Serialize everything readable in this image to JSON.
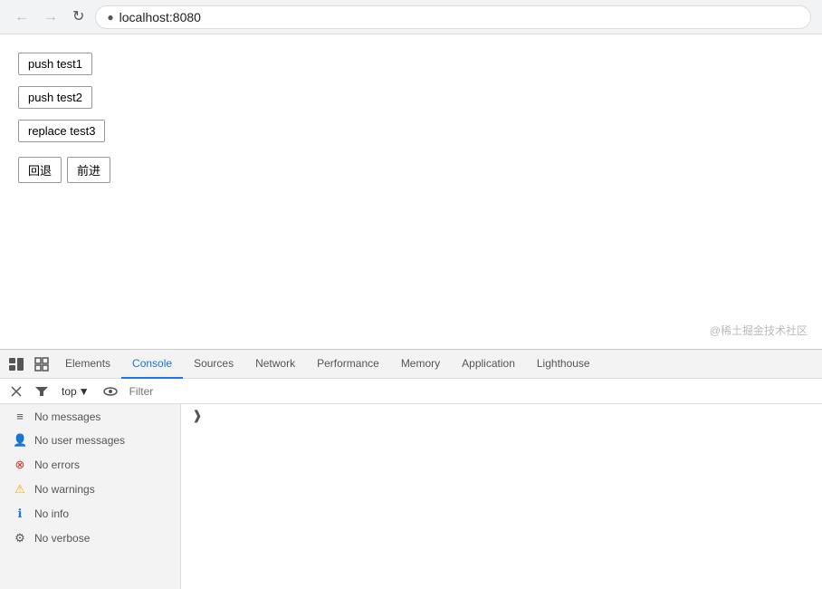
{
  "browser": {
    "url": "localhost:8080",
    "back_disabled": true,
    "forward_disabled": true
  },
  "page": {
    "btn1_label": "push test1",
    "btn2_label": "push test2",
    "btn3_label": "replace test3",
    "back_label": "回退",
    "forward_label": "前进",
    "watermark": "@稀土掘金技术社区"
  },
  "devtools": {
    "tabs": [
      "Elements",
      "Console",
      "Sources",
      "Network",
      "Performance",
      "Memory",
      "Application",
      "Lighthouse"
    ],
    "active_tab": "Console"
  },
  "console": {
    "top_label": "top",
    "filter_placeholder": "Filter",
    "sidebar_items": [
      {
        "icon": "≡",
        "icon_class": "icon-messages",
        "label": "No messages"
      },
      {
        "icon": "👤",
        "icon_class": "icon-user",
        "label": "No user messages"
      },
      {
        "icon": "⊗",
        "icon_class": "icon-error",
        "label": "No errors"
      },
      {
        "icon": "⚠",
        "icon_class": "icon-warning",
        "label": "No warnings"
      },
      {
        "icon": "ℹ",
        "icon_class": "icon-info",
        "label": "No info"
      },
      {
        "icon": "⚙",
        "icon_class": "icon-verbose",
        "label": "No verbose"
      }
    ]
  }
}
